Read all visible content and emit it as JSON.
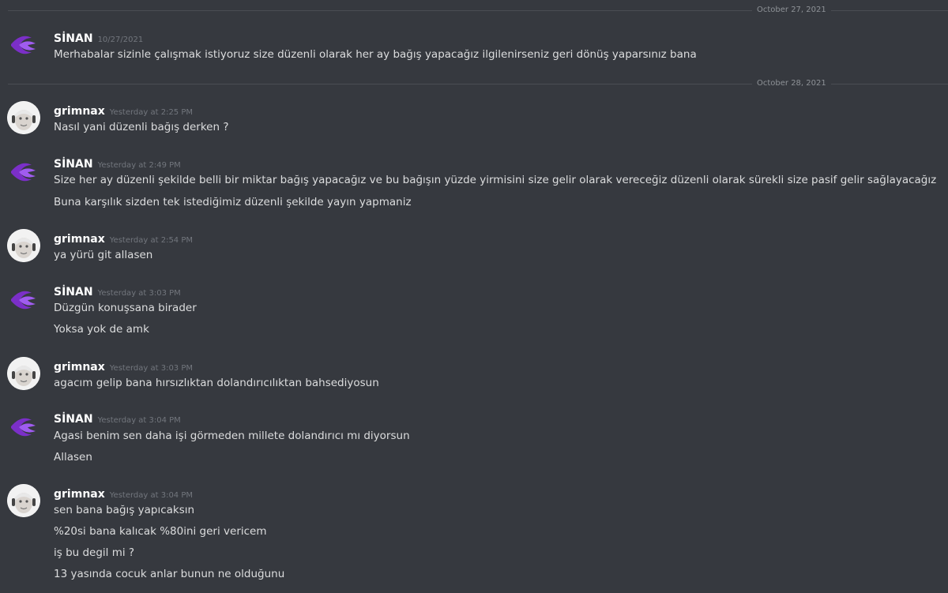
{
  "dividers": [
    {
      "label": "October 27, 2021"
    },
    {
      "label": "October 28, 2021"
    }
  ],
  "messages": [
    {
      "author": "SİNAN",
      "timestamp": "10/27/2021",
      "avatar": "purple-logo-icon",
      "lines": [
        "Merhabalar sizinle çalışmak istiyoruz size düzenli olarak her ay bağış yapacağız ilgilenirseniz geri dönüş yaparsınız bana"
      ]
    },
    {
      "author": "grimnax",
      "timestamp": "Yesterday at 2:25 PM",
      "avatar": "face-avatar-icon",
      "lines": [
        "Nasıl yani düzenli bağış derken ?"
      ]
    },
    {
      "author": "SİNAN",
      "timestamp": "Yesterday at 2:49 PM",
      "avatar": "purple-logo-icon",
      "lines": [
        "Size her ay düzenli şekilde belli bir miktar bağış yapacağız ve bu bağışın yüzde yirmisini size gelir olarak vereceğiz düzenli olarak sürekli size pasif gelir sağlayacağız",
        "Buna karşılık sizden tek istediğimiz düzenli şekilde yayın yapmaniz"
      ]
    },
    {
      "author": "grimnax",
      "timestamp": "Yesterday at 2:54 PM",
      "avatar": "face-avatar-icon",
      "lines": [
        "ya yürü git allasen"
      ]
    },
    {
      "author": "SİNAN",
      "timestamp": "Yesterday at 3:03 PM",
      "avatar": "purple-logo-icon",
      "lines": [
        "Düzgün konuşsana birader",
        "Yoksa yok de amk"
      ]
    },
    {
      "author": "grimnax",
      "timestamp": "Yesterday at 3:03 PM",
      "avatar": "face-avatar-icon",
      "lines": [
        "agacım gelip bana hırsızlıktan dolandırıcılıktan bahsediyosun"
      ]
    },
    {
      "author": "SİNAN",
      "timestamp": "Yesterday at 3:04 PM",
      "avatar": "purple-logo-icon",
      "lines": [
        "Agasi benim sen daha işi görmeden millete dolandırıcı mı diyorsun",
        "Allasen"
      ]
    },
    {
      "author": "grimnax",
      "timestamp": "Yesterday at 3:04 PM",
      "avatar": "face-avatar-icon",
      "lines": [
        "sen bana bağış yapıcaksın",
        "%20si bana kalıcak %80ini geri vericem",
        "iş bu degil mi ?",
        "13 yasında cocuk anlar bunun ne olduğunu"
      ]
    }
  ],
  "colors": {
    "background": "#36393f",
    "author": "#ffffff",
    "text": "#dcddde",
    "timestamp": "#72767d",
    "logo": "#8a3bd8"
  }
}
